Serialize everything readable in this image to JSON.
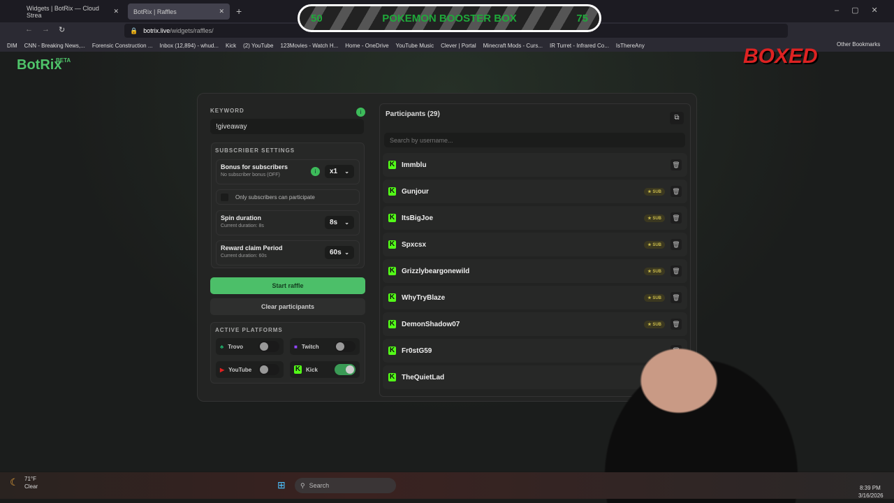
{
  "browser": {
    "tabs": [
      {
        "label": "Widgets | BotRix — Cloud Strea"
      },
      {
        "label": "BotRix | Raffles"
      }
    ],
    "url_domain": "botrix.live",
    "url_path": "/widgets/raffles/",
    "bookmarks": [
      "DIM",
      "CNN - Breaking News,...",
      "Forensic Construction ...",
      "Inbox (12,894) - whud...",
      "Kick",
      "(2) YouTube",
      "123Movies - Watch H...",
      "Home - OneDrive",
      "YouTube Music",
      "Clever | Portal",
      "Minecraft Mods - Curs...",
      "IR Turret - Infrared Co...",
      "IsThereAny"
    ],
    "other_bookmarks": "Other Bookmarks"
  },
  "overlay": {
    "left": "50",
    "title": "POKEMON BOOSTER BOX",
    "right": "75",
    "logo": "BOXED"
  },
  "app": {
    "logo": "BotRix",
    "beta": "BETA"
  },
  "keyword": {
    "label": "KEYWORD",
    "value": "!giveaway"
  },
  "subscriber": {
    "label": "SUBSCRIBER SETTINGS",
    "bonus_title": "Bonus for subscribers",
    "bonus_sub": "No subscriber bonus (OFF)",
    "bonus_value": "x1",
    "only_subs": "Only subscribers can participate",
    "spin_title": "Spin duration",
    "spin_sub": "Current duration: 8s",
    "spin_value": "8s",
    "claim_title": "Reward claim Period",
    "claim_sub": "Current duration: 60s",
    "claim_value": "60s"
  },
  "buttons": {
    "start": "Start raffle",
    "clear": "Clear participants"
  },
  "platforms": {
    "label": "ACTIVE PLATFORMS",
    "items": [
      {
        "name": "Trovo",
        "on": false
      },
      {
        "name": "Twitch",
        "on": false
      },
      {
        "name": "YouTube",
        "on": false
      },
      {
        "name": "Kick",
        "on": true
      }
    ]
  },
  "participants": {
    "title": "Participants (29)",
    "search_placeholder": "Search by username...",
    "sub_badge": "SUB",
    "list": [
      {
        "name": "Immblu",
        "sub": false
      },
      {
        "name": "Gunjour",
        "sub": true
      },
      {
        "name": "ItsBigJoe",
        "sub": true
      },
      {
        "name": "Spxcsx",
        "sub": true
      },
      {
        "name": "Grizzlybeargonewild",
        "sub": true
      },
      {
        "name": "WhyTryBlaze",
        "sub": true
      },
      {
        "name": "DemonShadow07",
        "sub": true
      },
      {
        "name": "Fr0stG59",
        "sub": false
      },
      {
        "name": "TheQuietLad",
        "sub": false
      }
    ]
  },
  "taskbar": {
    "temp": "71°F",
    "weather": "Clear",
    "search": "Search",
    "time": "8:39 PM",
    "date": "3/16/2026"
  }
}
